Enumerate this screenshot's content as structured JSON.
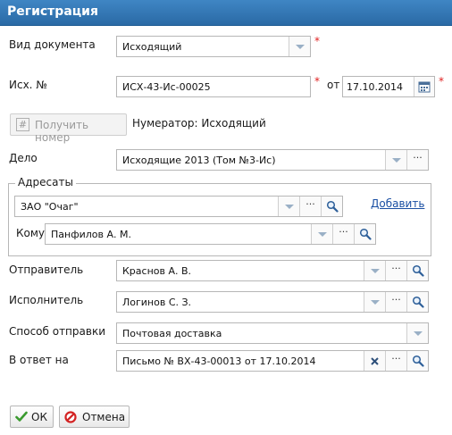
{
  "window": {
    "title": "Регистрация"
  },
  "labels": {
    "doc_type": "Вид документа",
    "out_number": "Исх. №",
    "from": "от",
    "numerator": "Нумератор: Исходящий",
    "case": "Дело",
    "addressees": "Адресаты",
    "to_whom": "Кому",
    "sender": "Отправитель",
    "executor": "Исполнитель",
    "send_method": "Способ отправки",
    "in_reply_to": "В ответ на"
  },
  "fields": {
    "doc_type": "Исходящий",
    "out_number": "ИСХ-43-Ис-00025",
    "date": "17.10.2014",
    "case": "Исходящие 2013  (Том №3-Ис)",
    "addressee_org": "ЗАО \"Очаг\"",
    "to_whom": "Панфилов А. М.",
    "sender": "Краснов  А. В.",
    "executor": "Логинов С. З.",
    "send_method": "Почтовая доставка",
    "in_reply_to": "Письмо № ВХ-43-00013 от 17.10.2014"
  },
  "buttons": {
    "get_number": "Получить номер",
    "add": "Добавить",
    "ok": "ОК",
    "cancel": "Отмена",
    "more": "···"
  },
  "required_mark": "*",
  "colors": {
    "title_bar": "#3175b5",
    "required": "#e02020",
    "link": "#1a4fa3"
  },
  "icons": [
    "dropdown-icon",
    "ellipsis-icon",
    "search-icon",
    "calendar-icon",
    "clear-icon",
    "check-icon",
    "cancel-icon",
    "hash-icon"
  ]
}
